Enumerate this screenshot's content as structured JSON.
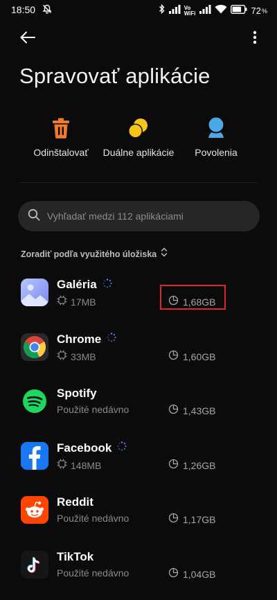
{
  "status_bar": {
    "time": "18:50",
    "battery_pct": "72",
    "icons": [
      "mute-icon",
      "bluetooth-icon",
      "signal-icon",
      "vowifi-icon",
      "signal-icon",
      "wifi-icon",
      "battery-icon"
    ],
    "vowifi_top": "Vo",
    "vowifi_bottom": "WiFi"
  },
  "header": {
    "title": "Spravovať aplikácie",
    "back_icon": "back-arrow-icon",
    "menu_icon": "more-vertical-icon"
  },
  "actions": [
    {
      "label": "Odinštalovať",
      "icon": "trash-icon",
      "color": "#f07a2f"
    },
    {
      "label": "Duálne aplikácie",
      "icon": "dual-apps-icon",
      "color": "#f5c518"
    },
    {
      "label": "Povolenia",
      "icon": "permissions-icon",
      "color": "#4aa8e8"
    }
  ],
  "search": {
    "placeholder": "Vyhľadať medzi 112 aplikáciami",
    "icon": "search-icon"
  },
  "sort": {
    "label": "Zoradiť podľa využitého úložiska",
    "icon": "sort-toggle-icon"
  },
  "apps": [
    {
      "name": "Galéria",
      "sub": "17MB",
      "sub_icon": "chip-icon",
      "size": "1,68GB",
      "loading": true,
      "highlighted": true
    },
    {
      "name": "Chrome",
      "sub": "33MB",
      "sub_icon": "chip-icon",
      "size": "1,60GB",
      "loading": true,
      "highlighted": false
    },
    {
      "name": "Spotify",
      "sub": "Použité nedávno",
      "sub_icon": "",
      "size": "1,43GB",
      "loading": false,
      "highlighted": false
    },
    {
      "name": "Facebook",
      "sub": "148MB",
      "sub_icon": "chip-icon",
      "size": "1,26GB",
      "loading": true,
      "highlighted": false
    },
    {
      "name": "Reddit",
      "sub": "Použité nedávno",
      "sub_icon": "",
      "size": "1,17GB",
      "loading": false,
      "highlighted": false
    },
    {
      "name": "TikTok",
      "sub": "Použité nedávno",
      "sub_icon": "",
      "size": "1,04GB",
      "loading": false,
      "highlighted": false
    }
  ],
  "colors": {
    "background": "#0b0b0b",
    "highlight": "#e0262b",
    "search_bg": "#262626",
    "spinner": "#4c8dff"
  }
}
